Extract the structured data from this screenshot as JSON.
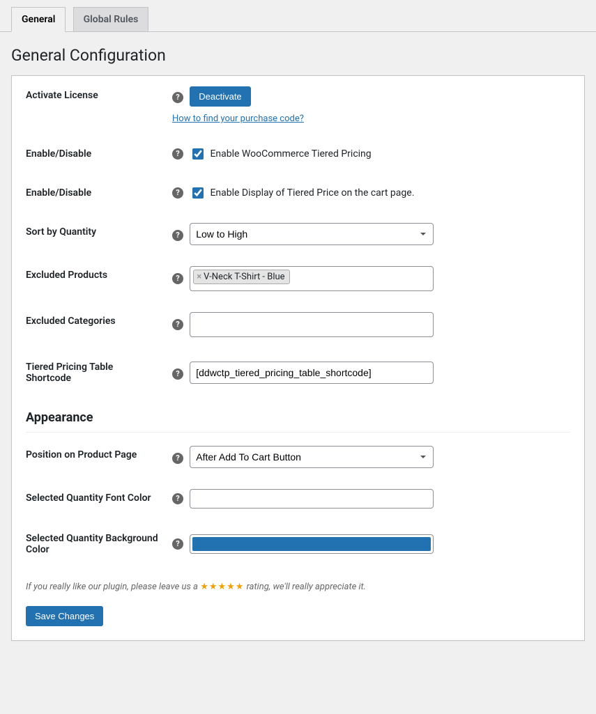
{
  "tabs": {
    "general": "General",
    "global_rules": "Global Rules"
  },
  "page_title": "General Configuration",
  "rows": {
    "activate_license": {
      "label": "Activate License",
      "button": "Deactivate",
      "link": "How to find your purchase code?"
    },
    "enable_disable_1": {
      "label": "Enable/Disable",
      "checkbox_label": "Enable WooCommerce Tiered Pricing"
    },
    "enable_disable_2": {
      "label": "Enable/Disable",
      "checkbox_label": "Enable Display of Tiered Price on the cart page."
    },
    "sort_by_quantity": {
      "label": "Sort by Quantity",
      "value": "Low to High"
    },
    "excluded_products": {
      "label": "Excluded Products",
      "tags": [
        "V-Neck T-Shirt - Blue"
      ]
    },
    "excluded_categories": {
      "label": "Excluded Categories"
    },
    "shortcode": {
      "label": "Tiered Pricing Table Shortcode",
      "value": "[ddwctp_tiered_pricing_table_shortcode]"
    }
  },
  "appearance": {
    "title": "Appearance",
    "position": {
      "label": "Position on Product Page",
      "value": "After Add To Cart Button"
    },
    "font_color": {
      "label": "Selected Quantity Font Color",
      "value": "#ffffff"
    },
    "bg_color": {
      "label": "Selected Quantity Background Color",
      "value": "#2271b1"
    }
  },
  "rating_note": {
    "prefix": "If you really like our plugin, please leave us a ",
    "stars": "★★★★★",
    "suffix": " rating, we'll really appreciate it."
  },
  "save_button": "Save Changes"
}
